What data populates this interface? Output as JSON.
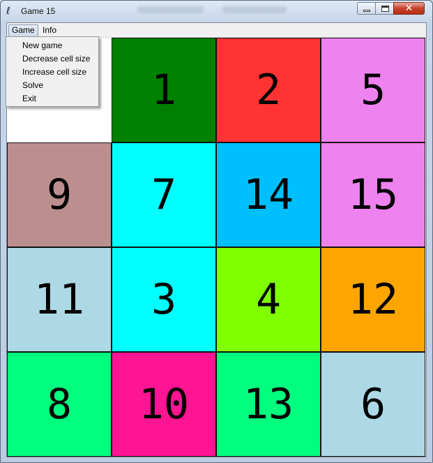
{
  "window": {
    "title": "Game 15",
    "close_symbol": "✕"
  },
  "menubar": {
    "items": [
      {
        "label": "Game"
      },
      {
        "label": "Info"
      }
    ]
  },
  "game_menu": {
    "items": [
      {
        "label": "New game"
      },
      {
        "label": "Decrease cell size"
      },
      {
        "label": "Increase cell size"
      },
      {
        "label": "Solve"
      },
      {
        "label": "Exit"
      }
    ]
  },
  "board": {
    "rows": 4,
    "cols": 4,
    "tiles": [
      [
        null,
        {
          "n": "1",
          "color": "#008000"
        },
        {
          "n": "2",
          "color": "#ff3333"
        },
        {
          "n": "5",
          "color": "#ee82ee"
        }
      ],
      [
        {
          "n": "9",
          "color": "#bc8f8f"
        },
        {
          "n": "7",
          "color": "#00ffff"
        },
        {
          "n": "14",
          "color": "#00bfff"
        },
        {
          "n": "15",
          "color": "#ee82ee"
        }
      ],
      [
        {
          "n": "11",
          "color": "#add8e6"
        },
        {
          "n": "3",
          "color": "#00ffff"
        },
        {
          "n": "4",
          "color": "#7fff00"
        },
        {
          "n": "12",
          "color": "#ffa500"
        }
      ],
      [
        {
          "n": "8",
          "color": "#00ff7f"
        },
        {
          "n": "10",
          "color": "#ff1493"
        },
        {
          "n": "13",
          "color": "#00ff7f"
        },
        {
          "n": "6",
          "color": "#add8e6"
        }
      ]
    ]
  }
}
